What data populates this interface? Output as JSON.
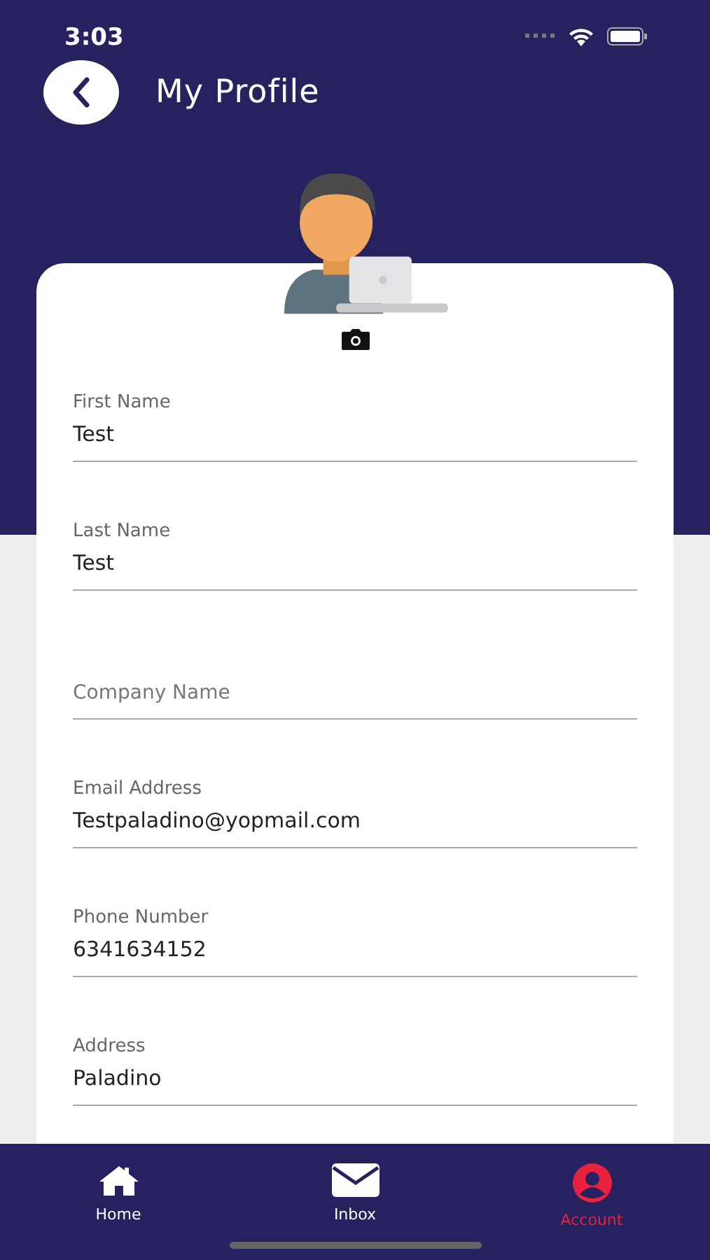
{
  "status_bar": {
    "time": "3:03"
  },
  "header": {
    "title": "My Profile"
  },
  "fields": [
    {
      "label": "First Name",
      "value": "Test"
    },
    {
      "label": "Last Name",
      "value": "Test"
    },
    {
      "placeholder": "Company Name"
    },
    {
      "label": "Email Address",
      "value": "Testpaladino@yopmail.com"
    },
    {
      "label": "Phone Number",
      "value": "6341634152"
    },
    {
      "label": "Address",
      "value": "Paladino"
    }
  ],
  "tabs": [
    {
      "label": "Home",
      "kind": "home",
      "selected": false
    },
    {
      "label": "Inbox",
      "kind": "inbox",
      "selected": false
    },
    {
      "label": "Account",
      "kind": "account",
      "selected": true
    }
  ]
}
